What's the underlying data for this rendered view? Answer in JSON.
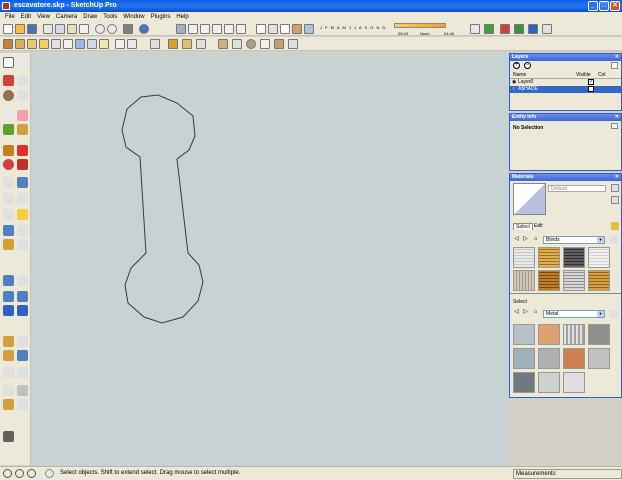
{
  "window": {
    "title": "escavatore.skp - SketchUp Pro",
    "buttons": [
      "_",
      "□",
      "✕"
    ]
  },
  "menubar": [
    "File",
    "Edit",
    "View",
    "Camera",
    "Draw",
    "Tools",
    "Window",
    "Plugins",
    "Help"
  ],
  "shadow_toolbar": {
    "months": "J F M A M J J A S O N D",
    "time_start": "06:43",
    "noon_label": "Noon",
    "time_end": "04:46"
  },
  "panels": {
    "layers": {
      "title": "Layers",
      "columns": [
        "Name",
        "Visible",
        "Col"
      ],
      "rows": [
        {
          "name": "Layer0",
          "selected": false
        },
        {
          "name": "A$HADE",
          "selected": true
        }
      ]
    },
    "entity_info": {
      "title": "Entity Info",
      "text": "No Selection"
    },
    "materials": {
      "title": "Materials",
      "preview_name": "Default",
      "tabs": [
        "Select",
        "Edit"
      ],
      "library_1": "Blinds",
      "lower_label": "Select",
      "library_2": "Metal"
    }
  },
  "statusbar": {
    "text": "Select objects. Shift to extend select. Drag mouse to select multiple.",
    "measurements_label": "Measurements"
  },
  "colors": {
    "viewport": "#c7d2d3",
    "title_blue": "#0a5ee8",
    "panel_border": "#2e5fd8",
    "selection": "#316ac5"
  }
}
